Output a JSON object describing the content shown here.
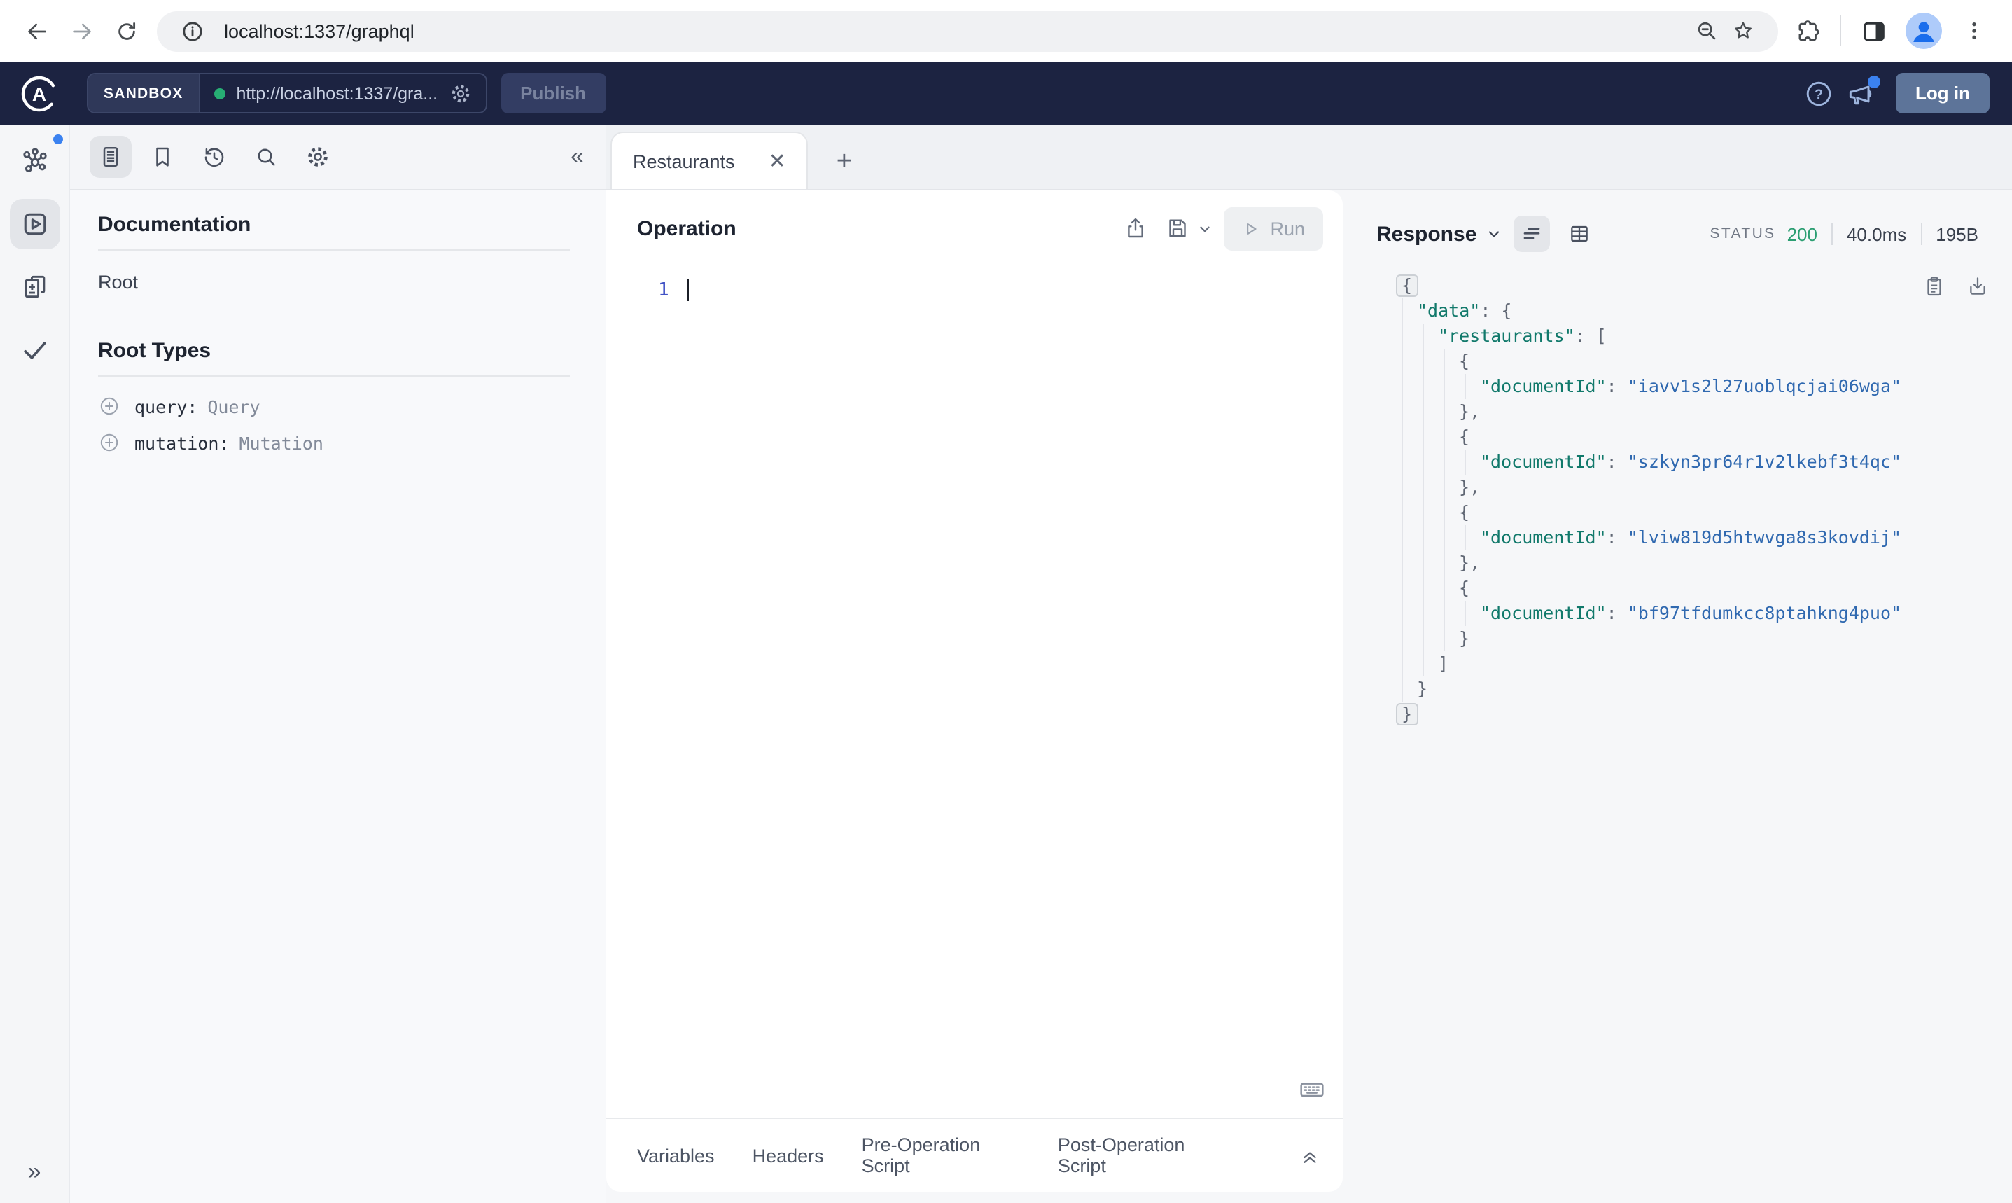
{
  "browser": {
    "url": "localhost:1337/graphql"
  },
  "apollo_header": {
    "sandbox_label": "SANDBOX",
    "endpoint_url": "http://localhost:1337/gra...",
    "publish_label": "Publish",
    "login_label": "Log in"
  },
  "docs": {
    "title": "Documentation",
    "root_link": "Root",
    "root_types_title": "Root Types",
    "root_types": [
      {
        "name": "query:",
        "type": "Query"
      },
      {
        "name": "mutation:",
        "type": "Mutation"
      }
    ]
  },
  "tabs": {
    "active_tab": "Restaurants"
  },
  "operation": {
    "title": "Operation",
    "run_label": "Run",
    "line_number": "1",
    "footer_tabs": [
      "Variables",
      "Headers",
      "Pre-Operation Script",
      "Post-Operation Script"
    ]
  },
  "response": {
    "title": "Response",
    "status_label": "STATUS",
    "status_code": "200",
    "time": "40.0ms",
    "size": "195B",
    "json_lines": [
      {
        "indent": 0,
        "box": true,
        "tokens": [
          [
            "punc",
            "{"
          ]
        ]
      },
      {
        "indent": 1,
        "tokens": [
          [
            "key",
            "\"data\""
          ],
          [
            "punc",
            ": {"
          ]
        ]
      },
      {
        "indent": 2,
        "tokens": [
          [
            "key",
            "\"restaurants\""
          ],
          [
            "punc",
            ": ["
          ]
        ]
      },
      {
        "indent": 3,
        "tokens": [
          [
            "punc",
            "{"
          ]
        ]
      },
      {
        "indent": 4,
        "tokens": [
          [
            "key",
            "\"documentId\""
          ],
          [
            "punc",
            ": "
          ],
          [
            "str",
            "\"iavv1s2l27uoblqcjai06wga\""
          ]
        ]
      },
      {
        "indent": 3,
        "tokens": [
          [
            "punc",
            "},"
          ]
        ]
      },
      {
        "indent": 3,
        "tokens": [
          [
            "punc",
            "{"
          ]
        ]
      },
      {
        "indent": 4,
        "tokens": [
          [
            "key",
            "\"documentId\""
          ],
          [
            "punc",
            ": "
          ],
          [
            "str",
            "\"szkyn3pr64r1v2lkebf3t4qc\""
          ]
        ]
      },
      {
        "indent": 3,
        "tokens": [
          [
            "punc",
            "},"
          ]
        ]
      },
      {
        "indent": 3,
        "tokens": [
          [
            "punc",
            "{"
          ]
        ]
      },
      {
        "indent": 4,
        "tokens": [
          [
            "key",
            "\"documentId\""
          ],
          [
            "punc",
            ": "
          ],
          [
            "str",
            "\"lviw819d5htwvga8s3kovdij\""
          ]
        ]
      },
      {
        "indent": 3,
        "tokens": [
          [
            "punc",
            "},"
          ]
        ]
      },
      {
        "indent": 3,
        "tokens": [
          [
            "punc",
            "{"
          ]
        ]
      },
      {
        "indent": 4,
        "tokens": [
          [
            "key",
            "\"documentId\""
          ],
          [
            "punc",
            ": "
          ],
          [
            "str",
            "\"bf97tfdumkcc8ptahkng4puo\""
          ]
        ]
      },
      {
        "indent": 3,
        "tokens": [
          [
            "punc",
            "}"
          ]
        ]
      },
      {
        "indent": 2,
        "tokens": [
          [
            "punc",
            "]"
          ]
        ]
      },
      {
        "indent": 1,
        "tokens": [
          [
            "punc",
            "}"
          ]
        ]
      },
      {
        "indent": 0,
        "box": true,
        "tokens": [
          [
            "punc",
            "}"
          ]
        ]
      }
    ]
  },
  "colors": {
    "header_bg": "#1c2341",
    "endpoint_dot_green": "#27ae74",
    "status_green": "#2b9e72",
    "json_key_teal": "#11796b",
    "json_string_blue": "#3069b0",
    "login_button_blue": "#5d7499",
    "notification_blue": "#3b82f0"
  }
}
